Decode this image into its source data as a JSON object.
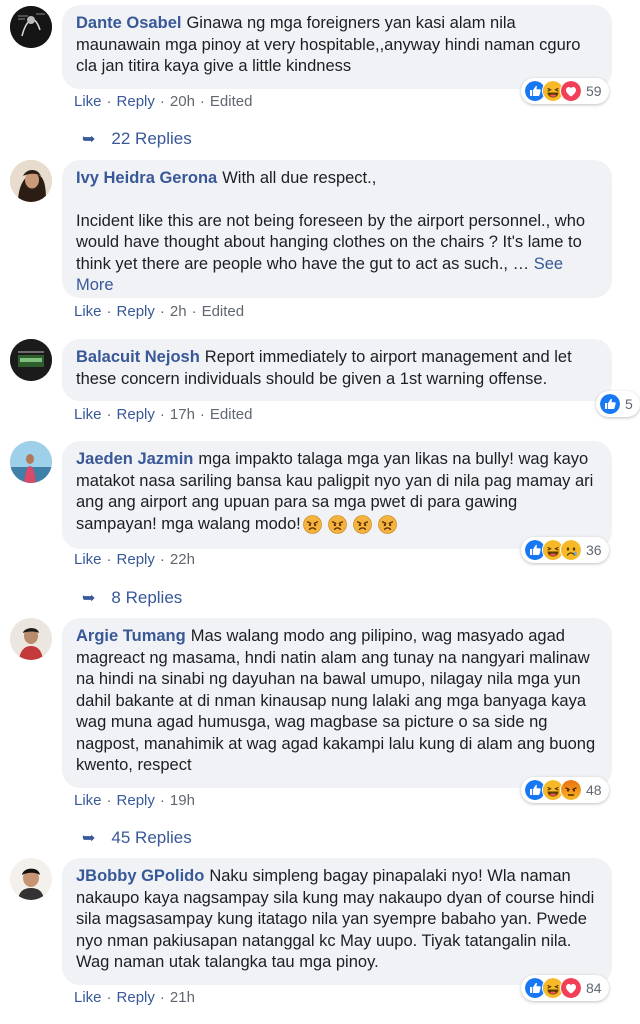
{
  "comments": [
    {
      "name": "Dante Osabel",
      "text": "Ginawa ng mga foreigners yan kasi alam nila maunawain mga pinoy at very hospitable,,anyway hindi naman cguro cla jan titira kaya give a little kindness",
      "actions": {
        "like": "Like",
        "reply": "Reply",
        "time": "20h",
        "edited": "Edited"
      },
      "reactions": {
        "icons": [
          "like-icon",
          "haha-icon",
          "love-icon"
        ],
        "count": "59"
      },
      "replies": "22 Replies"
    },
    {
      "name": "Ivy Heidra Gerona",
      "text": "With all due respect.,",
      "text2": "Incident like this are not being foreseen by the airport personnel., who would have thought about hanging clothes on the chairs ? It's lame to think yet there are people who have the gut to act as such., …",
      "see_more": "See More",
      "actions": {
        "like": "Like",
        "reply": "Reply",
        "time": "2h",
        "edited": "Edited"
      }
    },
    {
      "name": "Balacuit Nejosh",
      "text": "Report immediately to airport management and let these concern individuals should be given a 1st warning offense.",
      "actions": {
        "like": "Like",
        "reply": "Reply",
        "time": "17h",
        "edited": "Edited"
      },
      "reactions": {
        "icons": [
          "like-icon"
        ],
        "count": "5"
      }
    },
    {
      "name": "Jaeden Jazmin",
      "text": "mga impakto talaga mga yan likas na bully! wag kayo matakot nasa sariling bansa kau paligpit nyo yan di nila pag mamay ari ang ang airport ang upuan para sa mga pwet di para gawing sampayan! mga walang modo!",
      "emojis": [
        "angry-emoji",
        "angry-emoji",
        "angry-emoji",
        "angry-emoji"
      ],
      "actions": {
        "like": "Like",
        "reply": "Reply",
        "time": "22h"
      },
      "reactions": {
        "icons": [
          "like-icon",
          "haha-icon",
          "sad-icon"
        ],
        "count": "36"
      },
      "replies": "8 Replies"
    },
    {
      "name": "Argie Tumang",
      "text": "Mas walang modo ang pilipino, wag masyado agad magreact ng masama, hndi natin alam ang tunay na nangyari malinaw na hindi na sinabi ng dayuhan na bawal umupo, nilagay nila mga yun dahil bakante at di nman kinausap nung lalaki ang mga banyaga kaya wag muna agad humusga, wag magbase sa picture o sa side ng nagpost, manahimik at wag agad kakampi lalu kung di alam ang buong kwento, respect",
      "actions": {
        "like": "Like",
        "reply": "Reply",
        "time": "19h"
      },
      "reactions": {
        "icons": [
          "like-icon",
          "haha-icon",
          "angry-icon"
        ],
        "count": "48"
      },
      "replies": "45 Replies"
    },
    {
      "name": "JBobby GPolido",
      "text": "Naku simpleng bagay pinapalaki nyo! Wla naman nakaupo kaya nagsampay sila kung may nakaupo dyan of course hindi sila magsasampay kung itatago nila yan syempre babaho yan. Pwede nyo nman pakiusapan natanggal kc May uupo. Tiyak tatangalin nila. Wag naman utak talangka tau mga pinoy.",
      "actions": {
        "like": "Like",
        "reply": "Reply",
        "time": "21h"
      },
      "reactions": {
        "icons": [
          "like-icon",
          "haha-icon",
          "love-icon"
        ],
        "count": "84"
      }
    }
  ]
}
